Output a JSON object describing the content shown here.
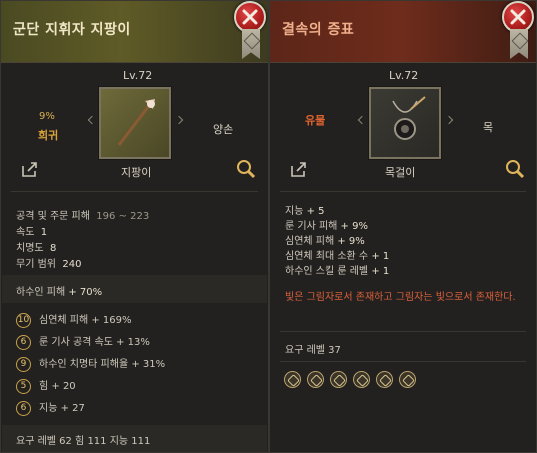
{
  "left": {
    "title": "군단 지휘자 지팡이",
    "level": "Lv.72",
    "grade_pct": "9%",
    "grade": "희귀",
    "bind": "양손",
    "item_type": "지팡이",
    "base_stats": [
      {
        "label": "공격 및 주문 피해",
        "value": "196 ~ 223"
      },
      {
        "label": "속도",
        "value": "1"
      },
      {
        "label": "치명도",
        "value": "8"
      },
      {
        "label": "무기 범위",
        "value": "240"
      }
    ],
    "implicit": {
      "label": "하수인 피해",
      "value": "+ 70%"
    },
    "engravings": [
      {
        "rune": "10",
        "label": "심연체 피해",
        "value": "+ 169%"
      },
      {
        "rune": "6",
        "label": "룬 기사 공격 속도",
        "value": "+ 13%"
      },
      {
        "rune": "9",
        "label": "하수인 치명타 피해율",
        "value": "+ 31%"
      },
      {
        "rune": "5",
        "label": "힘",
        "value": "+ 20"
      },
      {
        "rune": "6",
        "label": "지능",
        "value": "+ 27"
      }
    ],
    "requirement": "요구 레벨  62  힘  111  지능  111"
  },
  "right": {
    "title": "결속의 증표",
    "level": "Lv.72",
    "grade": "유물",
    "bind": "목",
    "item_type": "목걸이",
    "stats": [
      {
        "label": "지능",
        "value": "+ 5"
      },
      {
        "label": "룬 기사 피해",
        "value": "+ 9%"
      },
      {
        "label": "심연체 피해",
        "value": "+ 9%"
      },
      {
        "label": "심연체 최대 소환 수",
        "value": "+ 1"
      },
      {
        "label": "하수인 스킬 룬 레벨",
        "value": "+ 1"
      }
    ],
    "flavor": "빛은 그림자로서 존재하고 그림자는 빛으로서 존재한다.",
    "requirement": "요구 레벨  37"
  },
  "colors": {
    "rare": "#d9a43a",
    "relic": "#e0642e",
    "left_header": "#5f5b27",
    "right_header": "#6e2c1c"
  },
  "icons": [
    "close-icon",
    "bookmark-ribbon-icon",
    "share-icon",
    "magnify-icon",
    "staff-icon",
    "necklace-icon",
    "class-icon"
  ]
}
